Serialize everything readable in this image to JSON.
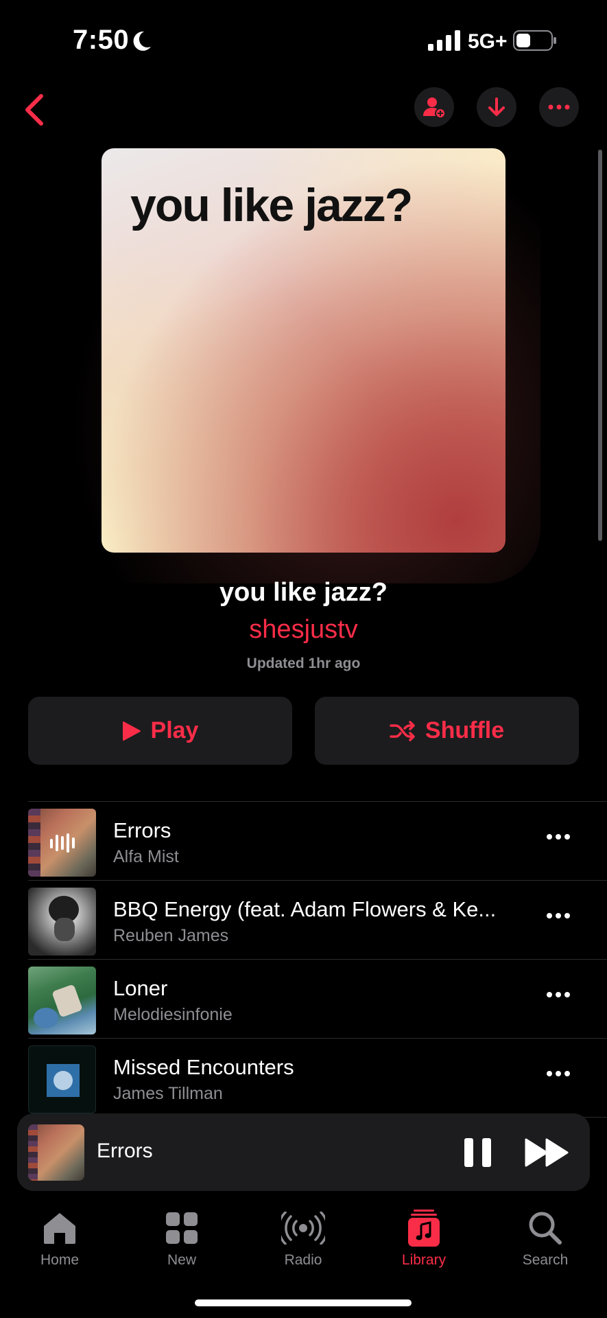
{
  "status": {
    "time": "7:50",
    "network": "5G+"
  },
  "playlist": {
    "artwork_text": "you like jazz?",
    "title": "you like jazz?",
    "owner": "shesjustv",
    "updated": "Updated 1hr ago"
  },
  "actions": {
    "play": "Play",
    "shuffle": "Shuffle"
  },
  "tracks": [
    {
      "title": "Errors",
      "artist": "Alfa Mist",
      "now_playing": true
    },
    {
      "title": "BBQ Energy (feat. Adam Flowers & Ke...",
      "artist": "Reuben James"
    },
    {
      "title": "Loner",
      "artist": "Melodiesinfonie"
    },
    {
      "title": "Missed Encounters",
      "artist": "James Tillman"
    }
  ],
  "mini_player": {
    "title": "Errors"
  },
  "tabs": [
    {
      "label": "Home",
      "icon": "house-icon"
    },
    {
      "label": "New",
      "icon": "grid-icon"
    },
    {
      "label": "Radio",
      "icon": "radio-waves-icon"
    },
    {
      "label": "Library",
      "icon": "music-library-icon",
      "active": true
    },
    {
      "label": "Search",
      "icon": "magnifier-icon"
    }
  ],
  "colors": {
    "accent": "#fa2d48",
    "surface": "#1c1c1e",
    "secondary_text": "#8e8e93"
  }
}
